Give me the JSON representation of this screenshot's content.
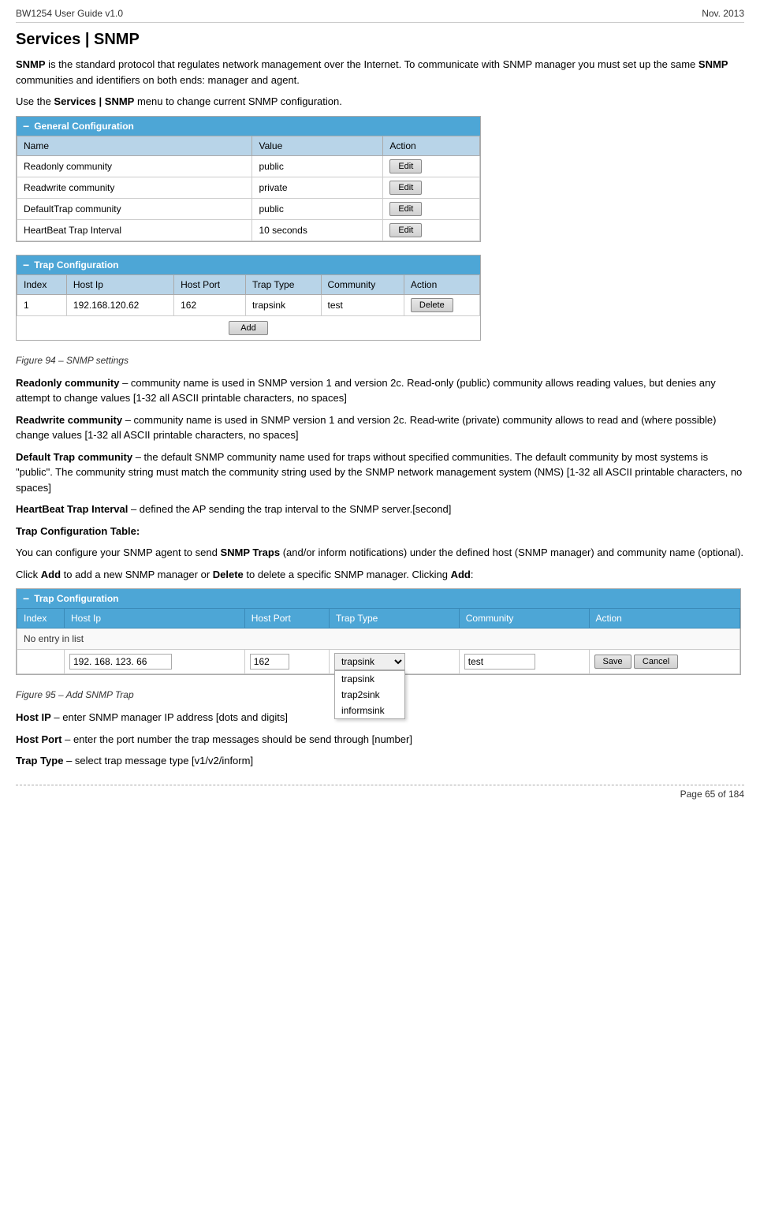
{
  "header": {
    "left": "BW1254 User Guide v1.0",
    "right": "Nov.  2013"
  },
  "page_title": "Services | SNMP",
  "intro": {
    "p1_bold": "SNMP",
    "p1_text": " is the standard protocol that regulates network management over the Internet. To communicate with SNMP manager you must set up the same ",
    "p1_bold2": "SNMP",
    "p1_text2": " communities and identifiers on both ends: manager and agent.",
    "p2_text": "Use the ",
    "p2_bold": "Services | SNMP",
    "p2_text2": " menu to change current SNMP configuration."
  },
  "general_config": {
    "title": "General Configuration",
    "headers": [
      "Name",
      "Value",
      "Action"
    ],
    "rows": [
      {
        "name": "Readonly community",
        "value": "public",
        "action": "Edit"
      },
      {
        "name": "Readwrite community",
        "value": "private",
        "action": "Edit"
      },
      {
        "name": "DefaultTrap community",
        "value": "public",
        "action": "Edit"
      },
      {
        "name": "HeartBeat Trap Interval",
        "value": "10 seconds",
        "action": "Edit"
      }
    ]
  },
  "trap_config_small": {
    "title": "Trap Configuration",
    "headers": [
      "Index",
      "Host Ip",
      "Host Port",
      "Trap Type",
      "Community",
      "Action"
    ],
    "rows": [
      {
        "index": "1",
        "host_ip": "192.168.120.62",
        "host_port": "162",
        "trap_type": "trapsink",
        "community": "test",
        "action": "Delete"
      }
    ],
    "add_label": "Add"
  },
  "figure94_caption": "Figure 94 – SNMP settings",
  "descriptions": [
    {
      "term": "Readonly community",
      "definition": " – community name is used in SNMP version 1 and version 2c. Read-only (public) community allows reading values, but denies any attempt to change values [1-32 all ASCII printable characters, no spaces]"
    },
    {
      "term": "Readwrite community",
      "definition": " – community name is used in SNMP version 1 and version 2c. Read-write (private) community allows to read and (where possible) change values [1-32 all ASCII printable characters, no spaces]"
    },
    {
      "term": "Default Trap community",
      "definition": " – the default SNMP community name used for traps without specified communities. The default community by most systems is \"public\". The community string must match the community string used by the SNMP network management system (NMS) [1-32 all ASCII printable characters, no spaces]"
    },
    {
      "term": "HeartBeat Trap Interval",
      "definition": "  – defined the AP sending the trap interval to the SNMP server.[second]"
    },
    {
      "term": "Trap Configuration Table:",
      "definition": ""
    }
  ],
  "trap_config_desc1": "You can configure your SNMP agent to send ",
  "trap_config_bold": "SNMP Traps",
  "trap_config_desc2": " (and/or inform notifications) under the defined host (SNMP manager) and community name (optional).",
  "click_desc_pre": "Click ",
  "click_add": "Add",
  "click_desc_mid": " to add a new SNMP manager or ",
  "click_delete": "Delete",
  "click_desc_post": " to delete a specific SNMP manager. Clicking ",
  "click_add2": "Add",
  "click_colon": ":",
  "trap_config_large": {
    "title": "Trap Configuration",
    "headers": [
      "Index",
      "Host Ip",
      "Host Port",
      "Trap Type",
      "Community",
      "Action"
    ],
    "no_entry": "No entry in list",
    "input_row": {
      "host_ip_value": "192. 168. 123. 66",
      "host_ip_placeholder": "",
      "host_port_value": "162",
      "trap_type_value": "trapsink",
      "trap_type_options": [
        "trapsink",
        "trap2sink",
        "informsink"
      ],
      "community_value": "test",
      "save_label": "Save",
      "cancel_label": "Cancel"
    }
  },
  "figure95_caption": "Figure 95 – Add SNMP Trap",
  "host_ip_desc": {
    "term": "Host IP",
    "definition": " – enter SNMP manager IP address [dots and digits]"
  },
  "host_port_desc": {
    "term": "Host Port",
    "definition": " – enter the port number the trap messages should be send through [number]"
  },
  "trap_type_desc": {
    "term": "Trap Type",
    "definition": " – select trap message type [v1/v2/inform]"
  },
  "footer": {
    "text": "Page 65 of 184"
  }
}
